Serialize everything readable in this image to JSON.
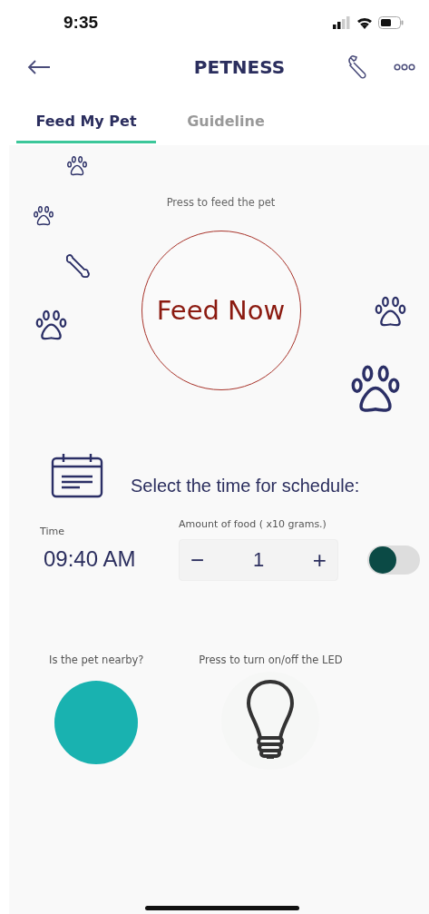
{
  "status_bar": {
    "time": "9:35"
  },
  "header": {
    "title": "PETNESS"
  },
  "tabs": [
    {
      "label": "Feed My Pet",
      "selected": true
    },
    {
      "label": "Guideline",
      "selected": false
    }
  ],
  "feed": {
    "hint": "Press to feed the pet",
    "button": "Feed Now"
  },
  "schedule": {
    "title": "Select the time for schedule:",
    "time_label": "Time",
    "time_value": "09:40 AM",
    "amount_label": "Amount of food ( x10 grams.)",
    "amount_value": "1",
    "decrement": "−",
    "increment": "+",
    "enabled": false
  },
  "sensors": {
    "nearby_label": "Is the pet nearby?",
    "led_label": "Press to turn on/off the LED"
  }
}
